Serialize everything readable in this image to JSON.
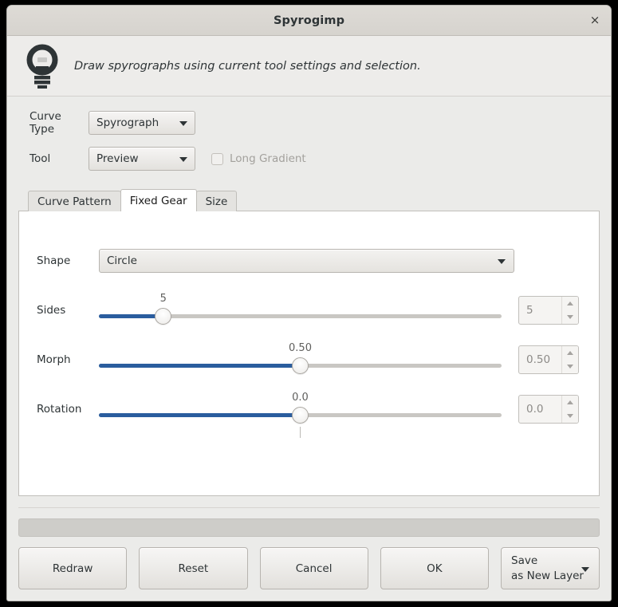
{
  "window": {
    "title": "Spyrogimp",
    "close_label": "×"
  },
  "banner": {
    "icon": "lightbulb-icon",
    "text": "Draw spyrographs using current tool settings and selection."
  },
  "form": {
    "curve_type": {
      "label": "Curve Type",
      "value": "Spyrograph"
    },
    "tool": {
      "label": "Tool",
      "value": "Preview"
    },
    "long_gradient": {
      "label": "Long Gradient",
      "checked": false,
      "enabled": false
    }
  },
  "tabs": [
    {
      "label": "Curve Pattern",
      "active": false
    },
    {
      "label": "Fixed Gear",
      "active": true
    },
    {
      "label": "Size",
      "active": false
    }
  ],
  "fixed_gear": {
    "shape": {
      "label": "Shape",
      "value": "Circle"
    },
    "sliders": [
      {
        "label": "Sides",
        "value_label": "5",
        "spin_value": "5",
        "fill_percent": 16,
        "handle_percent": 16,
        "has_center_tick": false
      },
      {
        "label": "Morph",
        "value_label": "0.50",
        "spin_value": "0.50",
        "fill_percent": 50,
        "handle_percent": 50,
        "has_center_tick": false
      },
      {
        "label": "Rotation",
        "value_label": "0.0",
        "spin_value": "0.0",
        "fill_percent": 50,
        "handle_percent": 50,
        "has_center_tick": true
      }
    ]
  },
  "progress": {
    "value_percent": 0,
    "text": ""
  },
  "actions": {
    "redraw": "Redraw",
    "reset": "Reset",
    "cancel": "Cancel",
    "ok": "OK",
    "save_line1": "Save",
    "save_line2": "as New Layer"
  },
  "colors": {
    "accent": "#2a5d9e",
    "dialog_bg": "#ebebe9",
    "panel_bg": "#ffffff",
    "titlebar_bg": "#d9d6d1",
    "text": "#2e3436",
    "muted_text": "#8d8b88"
  }
}
